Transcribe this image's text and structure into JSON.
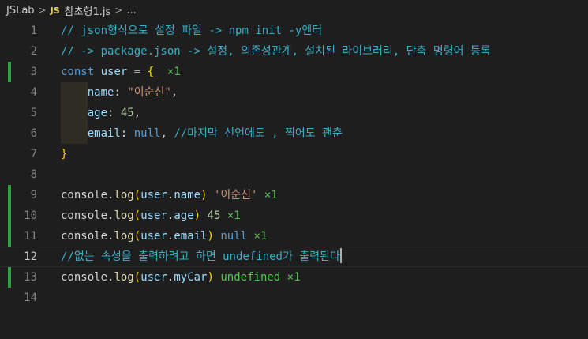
{
  "breadcrumb": {
    "folder": "JSLab",
    "sep1": ">",
    "file_icon": "JS",
    "file": "참초형1.js",
    "sep2": ">",
    "tail": "..."
  },
  "lines": [
    {
      "n": "1"
    },
    {
      "n": "2"
    },
    {
      "n": "3"
    },
    {
      "n": "4"
    },
    {
      "n": "5"
    },
    {
      "n": "6"
    },
    {
      "n": "7"
    },
    {
      "n": "8"
    },
    {
      "n": "9"
    },
    {
      "n": "10"
    },
    {
      "n": "11"
    },
    {
      "n": "12"
    },
    {
      "n": "13"
    },
    {
      "n": "14"
    }
  ],
  "code": {
    "l1": "// json형식으로 설정 파일 -> npm init -y엔터",
    "l2": "// -> package.json -> 설정, 의존성관계, 설치된 라이브러리, 단축 명령어 등록",
    "l3": {
      "kw": "const",
      "var": "user",
      "eq": " = ",
      "brace": "{",
      "result": "×1"
    },
    "l4": {
      "key": "name",
      "colon": ": ",
      "str": "\"이순신\"",
      "comma": ","
    },
    "l5": {
      "key": "age",
      "colon": ": ",
      "num": "45",
      "comma": ","
    },
    "l6": {
      "key": "email",
      "colon": ": ",
      "nul": "null",
      "comma": ", ",
      "comment": "//마지막 선언에도 , 찍어도 괜춘"
    },
    "l7": {
      "brace": "}"
    },
    "l9": {
      "obj": "console",
      "dot": ".",
      "fn": "log",
      "open": "(",
      "var": "user",
      "dot2": ".",
      "prop": "name",
      "close": ")",
      "res_str": "'이순신'",
      "res_x": "×1"
    },
    "l10": {
      "obj": "console",
      "dot": ".",
      "fn": "log",
      "open": "(",
      "var": "user",
      "dot2": ".",
      "prop": "age",
      "close": ")",
      "res_num": "45",
      "res_x": "×1"
    },
    "l11": {
      "obj": "console",
      "dot": ".",
      "fn": "log",
      "open": "(",
      "var": "user",
      "dot2": ".",
      "prop": "email",
      "close": ")",
      "res_null": "null",
      "res_x": "×1"
    },
    "l12": "//없는 속성을 출력하려고 하면 undefined가 출력된다",
    "l13": {
      "obj": "console",
      "dot": ".",
      "fn": "log",
      "open": "(",
      "var": "user",
      "dot2": ".",
      "prop": "myCar",
      "close": ")",
      "res_undef": "undefined",
      "res_x": "×1"
    }
  },
  "colors": {
    "background": "#1e1e1e",
    "comment": "#3ab0c8",
    "keyword": "#569cd6",
    "variable": "#9cdcfe",
    "string": "#ce9178",
    "number": "#b5cea8",
    "bracket_gold": "#ffd700",
    "bracket_purple": "#da70d6",
    "quokka_result": "#5fbf5f",
    "gutter_modified": "#2ea043"
  }
}
